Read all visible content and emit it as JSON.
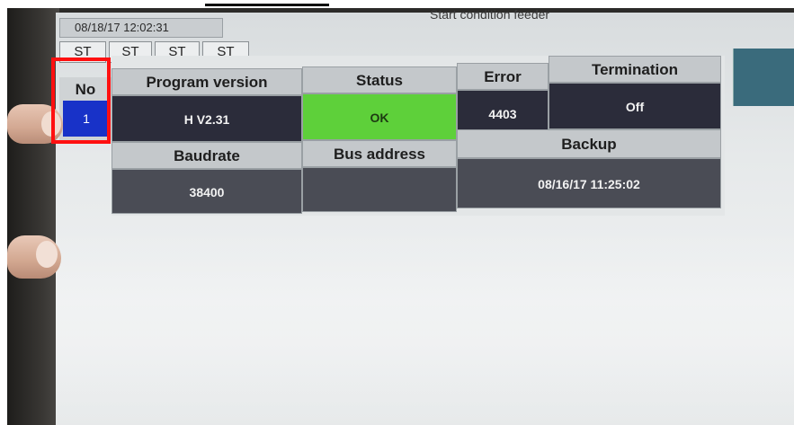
{
  "window": {
    "datetime": "08/18/17 12:02:31",
    "title": "Start condition feeder"
  },
  "tabs": [
    "ST",
    "ST",
    "ST",
    "ST"
  ],
  "table": {
    "no_header": "No",
    "no_value": "1",
    "headers": {
      "program_version": "Program version",
      "status": "Status",
      "error": "Error",
      "termination": "Termination",
      "baudrate": "Baudrate",
      "bus_address": "Bus address",
      "backup": "Backup"
    },
    "values": {
      "program_version": "H V2.31",
      "status": "OK",
      "error": "4403",
      "termination": "Off",
      "baudrate": "38400",
      "bus_address": "",
      "backup": "08/16/17 11:25:02"
    }
  },
  "colors": {
    "status_ok": "#5ed03a",
    "selected_no": "#1832c8",
    "highlight_box": "#ff1010",
    "cell_dark": "#2b2c3a"
  }
}
